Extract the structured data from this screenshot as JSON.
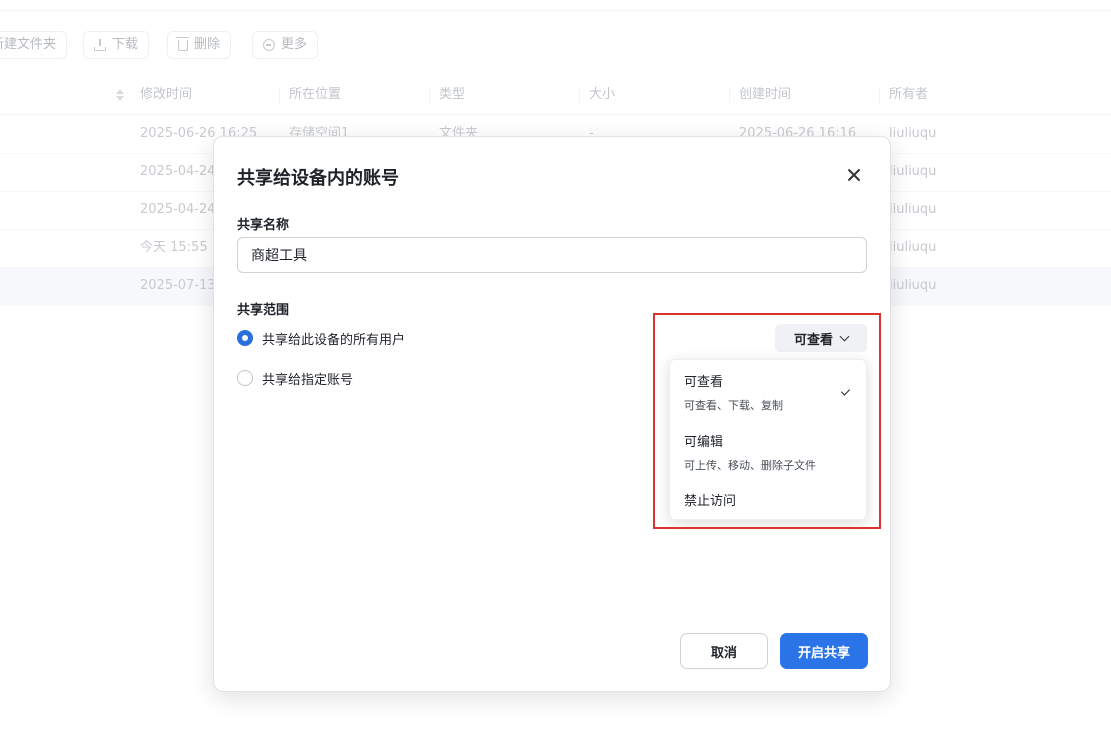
{
  "toolbar": {
    "new_folder": "新建文件夹",
    "download": "下载",
    "delete": "删除",
    "more": "更多"
  },
  "table": {
    "columns": [
      "修改时间",
      "所在位置",
      "类型",
      "大小",
      "创建时间",
      "所有者"
    ],
    "rows": [
      {
        "modified": "2025-06-26 16:25",
        "location": "存储空间1",
        "type": "文件夹",
        "size": "-",
        "created": "2025-06-26 16:16",
        "owner": "liuliuqu"
      },
      {
        "modified": "2025-04-24",
        "owner": "liuliuqu"
      },
      {
        "modified": "2025-04-24",
        "owner": "liuliuqu"
      },
      {
        "modified": "今天 15:55",
        "owner": "liuliuqu"
      },
      {
        "modified": "2025-07-13",
        "owner": "liuliuqu"
      }
    ]
  },
  "dialog": {
    "title": "共享给设备内的账号",
    "name_label": "共享名称",
    "name_value": "商超工具",
    "scope_label": "共享范围",
    "scope_all_users": "共享给此设备的所有用户",
    "scope_specific": "共享给指定账号",
    "permission_selected": "可查看",
    "options": [
      {
        "title": "可查看",
        "desc": "可查看、下载、复制",
        "selected": true
      },
      {
        "title": "可编辑",
        "desc": "可上传、移动、删除子文件"
      },
      {
        "title": "禁止访问",
        "desc": ""
      }
    ],
    "cancel": "取消",
    "confirm": "开启共享"
  },
  "colors": {
    "primary": "#2a74e8",
    "highlight": "#e03131"
  }
}
